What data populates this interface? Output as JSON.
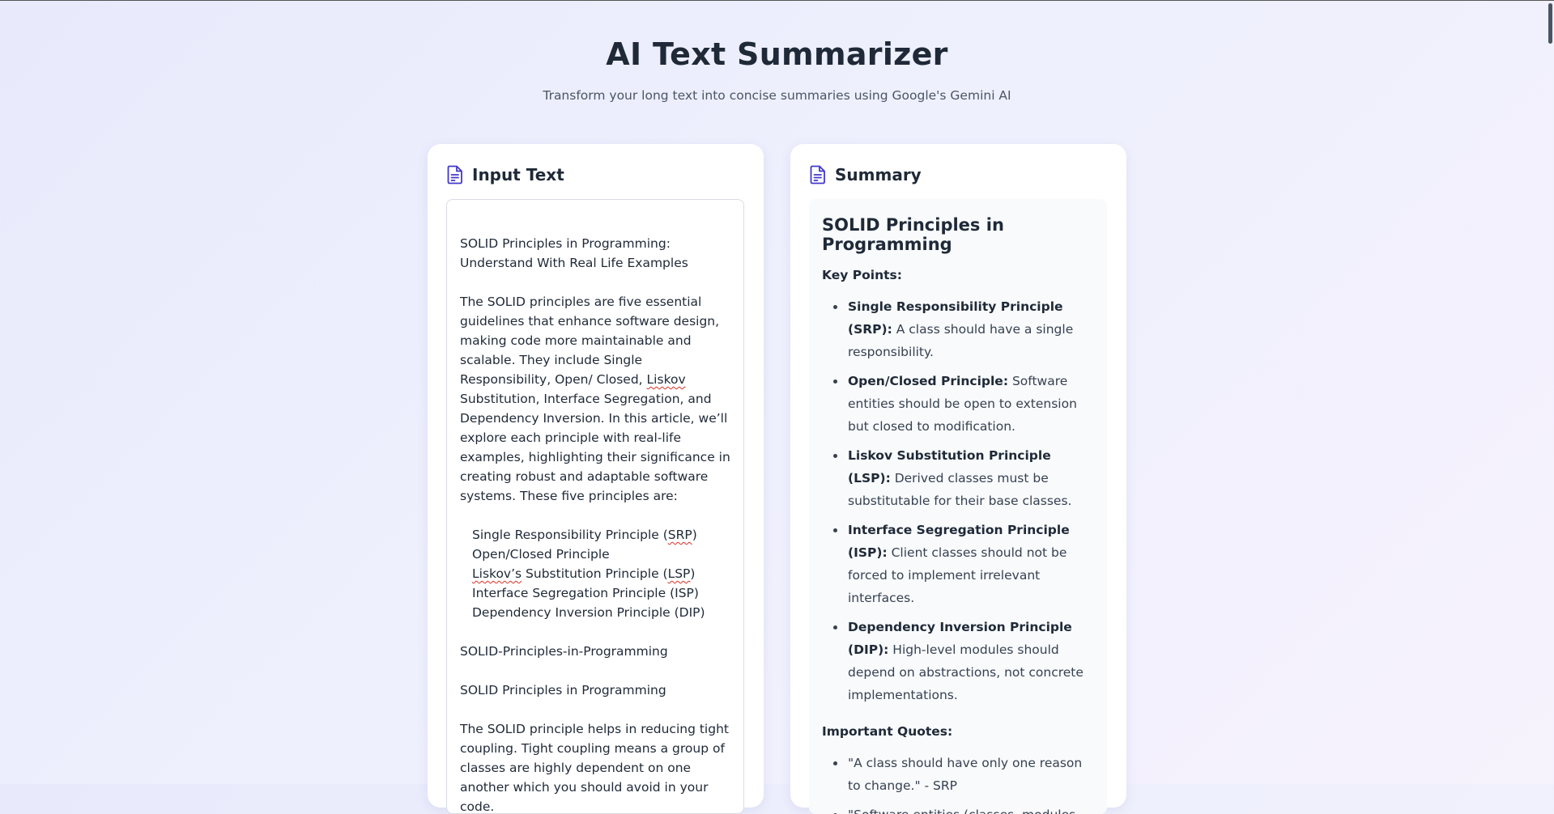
{
  "header": {
    "title": "AI Text Summarizer",
    "subtitle": "Transform your long text into concise summaries using Google's Gemini AI"
  },
  "input_card": {
    "icon": "document-icon",
    "title": "Input Text",
    "text": {
      "p1": "SOLID Principles in Programming: Understand With Real Life Examples",
      "p2a": "The SOLID principles are five essential guidelines that enhance software design, making code more maintainable and scalable. They include Single Responsibility, Open/ Closed, ",
      "p2_liskov": "Liskov",
      "p2b": " Substitution, Interface Segregation, and Dependency Inversion. In this article, we’ll explore each principle with real-life examples, highlighting their significance in creating robust and adaptable software systems. These five principles are:",
      "list": {
        "srp_a": "Single Responsibility Principle (",
        "srp_b": "SRP",
        "srp_c": ")",
        "ocp": "Open/Closed Principle",
        "lsp_a": "Liskov’s",
        "lsp_b": " Substitution Principle (",
        "lsp_c": "LSP",
        "lsp_d": ")",
        "isp": "Interface Segregation Principle (ISP)",
        "dip": "Dependency Inversion Principle (DIP)"
      },
      "p3": "SOLID-Principles-in-Programming",
      "p4": "SOLID Principles in Programming",
      "p5": "The SOLID principle helps in reducing tight coupling. Tight coupling means a group of classes are highly dependent on one another which you should avoid in your code."
    }
  },
  "summary_card": {
    "icon": "document-icon",
    "title": "Summary",
    "heading": "SOLID Principles in Programming",
    "key_points_label": "Key Points:",
    "key_points": [
      {
        "name": "Single Responsibility Principle (SRP):",
        "desc": " A class should have a single responsibility."
      },
      {
        "name": "Open/Closed Principle:",
        "desc": " Software entities should be open to extension but closed to modification."
      },
      {
        "name": "Liskov Substitution Principle (LSP):",
        "desc": " Derived classes must be substitutable for their base classes."
      },
      {
        "name": "Interface Segregation Principle (ISP):",
        "desc": " Client classes should not be forced to implement irrelevant interfaces."
      },
      {
        "name": "Dependency Inversion Principle (DIP):",
        "desc": " High-level modules should depend on abstractions, not concrete implementations."
      }
    ],
    "quotes_label": "Important Quotes:",
    "quotes": [
      "\"A class should have only one reason to change.\" - SRP",
      "\"Software entities (classes, modules,"
    ]
  },
  "colors": {
    "accent": "#4338ca",
    "text": "#1f2937",
    "muted": "#4b5563"
  }
}
